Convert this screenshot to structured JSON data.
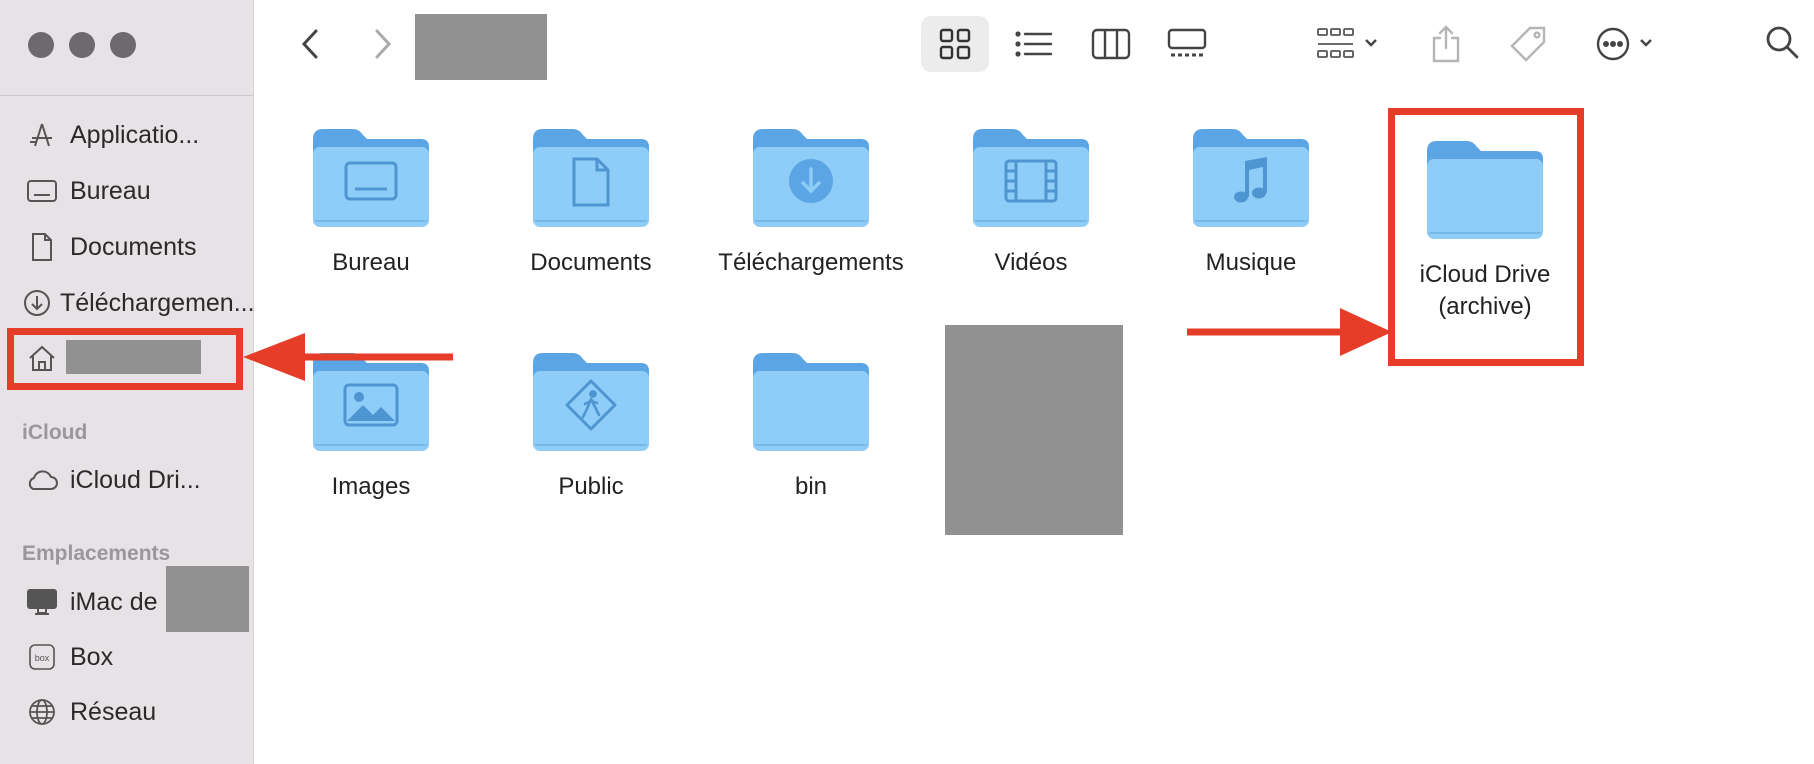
{
  "window": {
    "sidebar": {
      "favorites": [
        {
          "label": "Applicatio...",
          "icon": "applications-icon"
        },
        {
          "label": "Bureau",
          "icon": "desktop-icon"
        },
        {
          "label": "Documents",
          "icon": "document-icon"
        },
        {
          "label": "Téléchargements",
          "display": "Téléchargemen...",
          "icon": "download-icon"
        },
        {
          "label": "",
          "icon": "home-icon",
          "redacted": true
        }
      ],
      "icloud_title": "iCloud",
      "icloud_items": [
        {
          "label": "iCloud Dri...",
          "icon": "cloud-icon"
        }
      ],
      "locations_title": "Emplacements",
      "locations": [
        {
          "label": "iMac de",
          "icon": "imac-icon"
        },
        {
          "label": "Box",
          "icon": "box-icon"
        },
        {
          "label": "Réseau",
          "icon": "network-icon"
        }
      ]
    },
    "toolbar": {
      "view_modes": [
        "icon-view",
        "list-view",
        "column-view",
        "gallery-view"
      ],
      "active_view": "icon-view"
    },
    "folders": [
      {
        "label": "Bureau",
        "glyph": "desktop"
      },
      {
        "label": "Documents",
        "glyph": "document"
      },
      {
        "label": "Téléchargements",
        "glyph": "download"
      },
      {
        "label": "Vidéos",
        "glyph": "film"
      },
      {
        "label": "Musique",
        "glyph": "music"
      },
      {
        "label": "iCloud Drive (archive)",
        "label_line1": "iCloud Drive",
        "label_line2": "(archive)",
        "glyph": "none",
        "highlighted": true
      },
      {
        "label": "Images",
        "glyph": "image"
      },
      {
        "label": "Public",
        "glyph": "public"
      },
      {
        "label": "bin",
        "glyph": "none"
      }
    ],
    "colors": {
      "highlight": "#e63d29",
      "folder_body": "#8ecdf7",
      "folder_tab": "#5ba5e4",
      "sidebar_bg": "#e7e2e5"
    }
  }
}
